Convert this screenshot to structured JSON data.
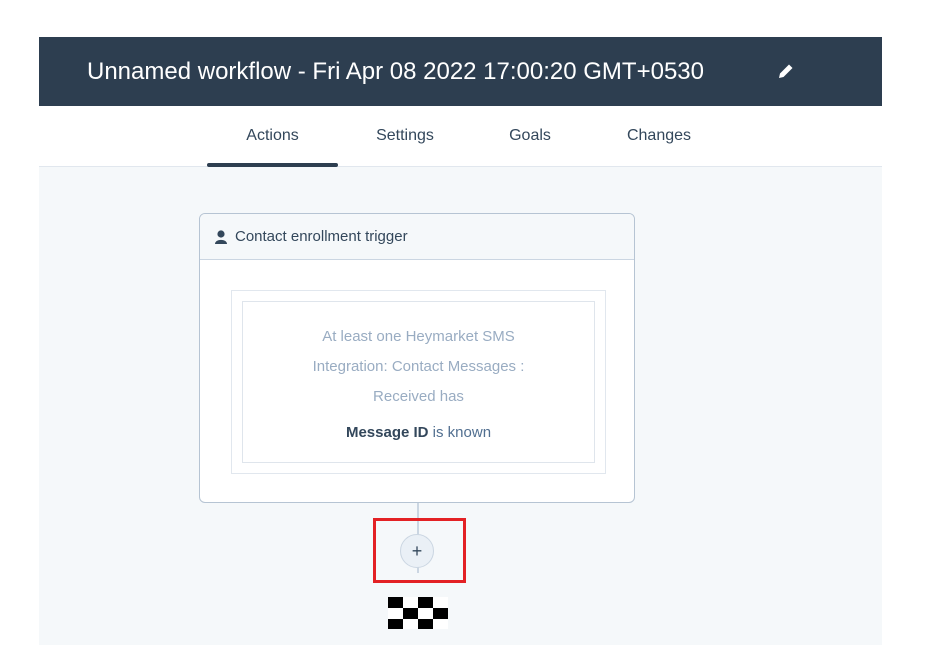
{
  "header": {
    "title": "Unnamed workflow - Fri Apr 08 2022 17:00:20 GMT+0530",
    "edit_icon": "pencil-icon"
  },
  "tabs": [
    {
      "label": "Actions",
      "active": true
    },
    {
      "label": "Settings",
      "active": false
    },
    {
      "label": "Goals",
      "active": false
    },
    {
      "label": "Changes",
      "active": false
    }
  ],
  "trigger": {
    "icon": "contact-icon",
    "label": "Contact enrollment trigger",
    "filter": {
      "line1": "At least one Heymarket SMS",
      "line2": "Integration: Contact Messages :",
      "line3": "Received has",
      "property": "Message ID",
      "condition": "is known"
    }
  },
  "add_action": {
    "symbol": "+",
    "icon": "plus-icon"
  },
  "end_marker": {
    "icon": "checkered-flag-icon"
  },
  "colors": {
    "header_bg": "#2d3e50",
    "canvas_bg": "#f5f8fa",
    "highlight": "#e32124",
    "text": "#33475b",
    "muted_text": "#99acc2"
  }
}
